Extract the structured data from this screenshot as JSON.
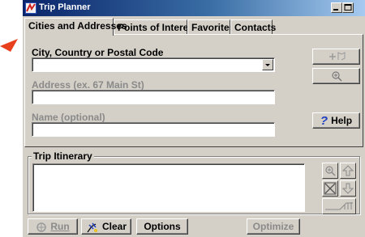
{
  "window": {
    "title": "Trip Planner"
  },
  "tabs": [
    {
      "label": "Cities and Addresses",
      "active": true
    },
    {
      "label": "Points of Interest",
      "active": false
    },
    {
      "label": "Favorites",
      "active": false
    },
    {
      "label": "Contacts",
      "active": false
    }
  ],
  "form": {
    "city_label": "City, Country or Postal Code",
    "city_value": "",
    "address_label": "Address (ex. 67 Main St)",
    "address_value": "",
    "name_label": "Name (optional)",
    "name_value": ""
  },
  "side_buttons": {
    "help_label": "Help"
  },
  "itinerary": {
    "title": "Trip Itinerary",
    "items": []
  },
  "bottom_buttons": {
    "run_label": "Run",
    "clear_label": "Clear",
    "options_label": "Options",
    "optimize_label": "Optimize"
  },
  "colors": {
    "title_bar": "#0a246a",
    "face": "#d4d0c8",
    "pointer_arrow": "#e8401c",
    "help_icon": "#1f3fbf"
  }
}
